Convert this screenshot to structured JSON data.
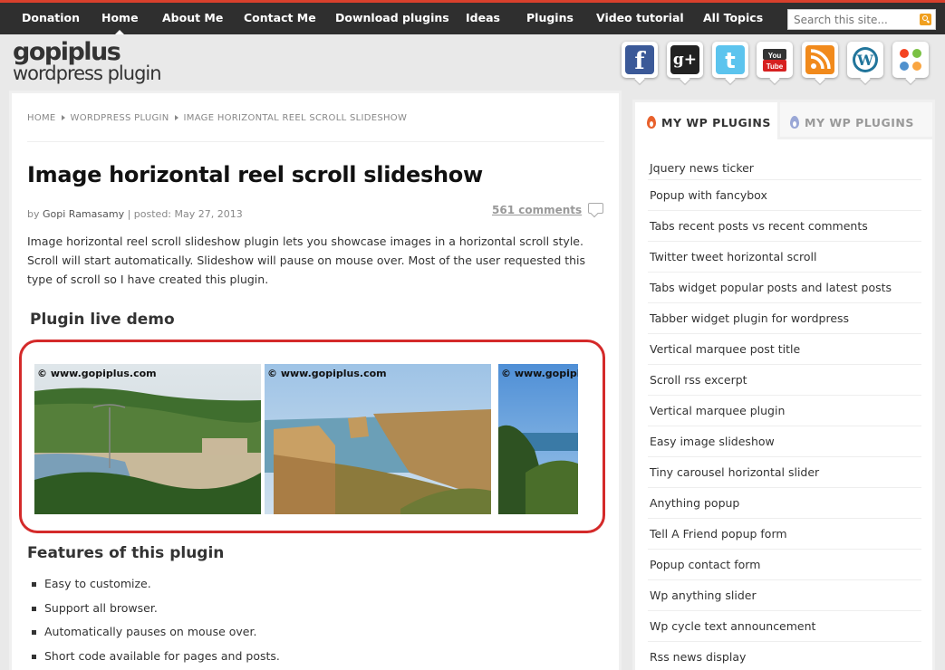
{
  "nav": {
    "items": [
      "Donation",
      "Home",
      "About Me",
      "Contact Me",
      "Download plugins",
      "Ideas",
      "Plugins",
      "Video tutorial",
      "All Topics"
    ],
    "active": "Home",
    "search_placeholder": "Search this site..."
  },
  "logo": {
    "line1": "gopiplus",
    "line2": "wordpress plugin"
  },
  "social": [
    "facebook-icon",
    "googleplus-icon",
    "twitter-icon",
    "youtube-icon",
    "rss-icon",
    "wordpress-icon",
    "joomla-icon"
  ],
  "breadcrumb": {
    "home": "HOME",
    "section": "WORDPRESS PLUGIN",
    "current": "IMAGE HORIZONTAL REEL SCROLL SLIDESHOW"
  },
  "post": {
    "title": "Image horizontal reel scroll slideshow",
    "by": "by",
    "author": "Gopi Ramasamy",
    "posted": "| posted: May 27, 2013",
    "comments": "561 comments",
    "intro": "Image horizontal reel scroll slideshow plugin lets you showcase images in a horizontal scroll style. Scroll will start automatically. Slideshow will pause on mouse over. Most of the user requested this type of scroll so I have created this plugin.",
    "demo_heading": "Plugin live demo",
    "slide_caption": "© www.gopiplus.com",
    "features_heading": "Features of this plugin",
    "features": [
      "Easy to customize.",
      "Support all browser.",
      "Automatically pauses on mouse over.",
      "Short code available for pages and posts."
    ]
  },
  "sidebar": {
    "tab_active": "MY WP PLUGINS",
    "tab_inactive": "MY WP PLUGINS",
    "plugins": [
      "Jquery news ticker",
      "Popup with fancybox",
      "Tabs recent posts vs recent comments",
      "Twitter tweet horizontal scroll",
      "Tabs widget popular posts and latest posts",
      "Tabber widget plugin for wordpress",
      "Vertical marquee post title",
      "Scroll rss excerpt",
      "Vertical marquee plugin",
      "Easy image slideshow",
      "Tiny carousel horizontal slider",
      "Anything popup",
      "Tell A Friend popup form",
      "Popup contact form",
      "Wp anything slider",
      "Wp cycle text announcement",
      "Rss news display"
    ]
  },
  "colors": {
    "nav_bg": "#2f2f2f",
    "nav_accent": "#d8402c",
    "demo_border": "#d42a2a"
  }
}
